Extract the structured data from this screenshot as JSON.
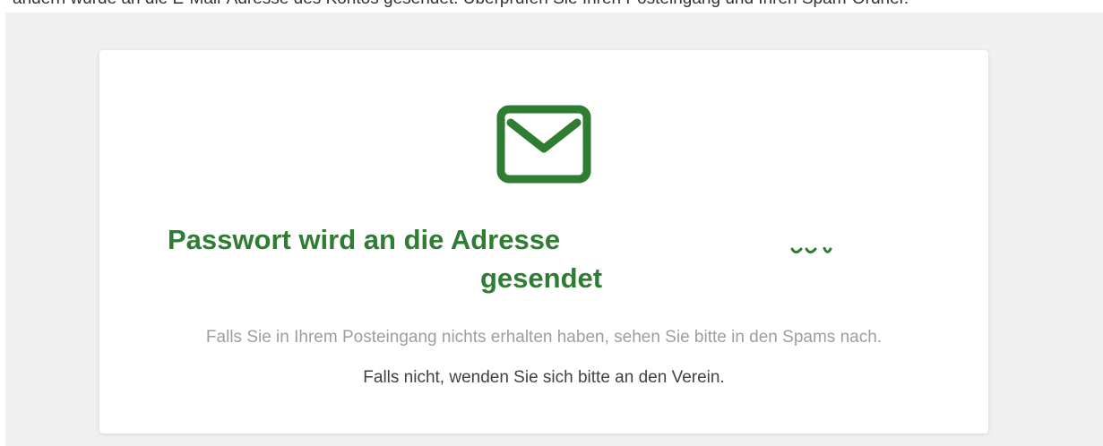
{
  "top_strip": {
    "text": "ändern wurde an die E-Mail-Adresse des Kontos gesendet. Überprüfen Sie Ihren Posteingang und Ihren Spam-Ordner."
  },
  "confirmation": {
    "icon": "mail-icon",
    "title_line_1": "Passwort wird an die Adresse",
    "title_line_2": "gesendet",
    "hint": "Falls Sie in Ihrem Posteingang nichts erhalten haben, sehen Sie bitte in den Spams nach.",
    "contact": "Falls nicht, wenden Sie sich bitte an den Verein."
  },
  "colors": {
    "accent_green": "#2e7d32",
    "page_background": "#f0f0f0",
    "card_background": "#ffffff",
    "hint_gray": "#9e9e9e",
    "body_text": "#424242"
  }
}
